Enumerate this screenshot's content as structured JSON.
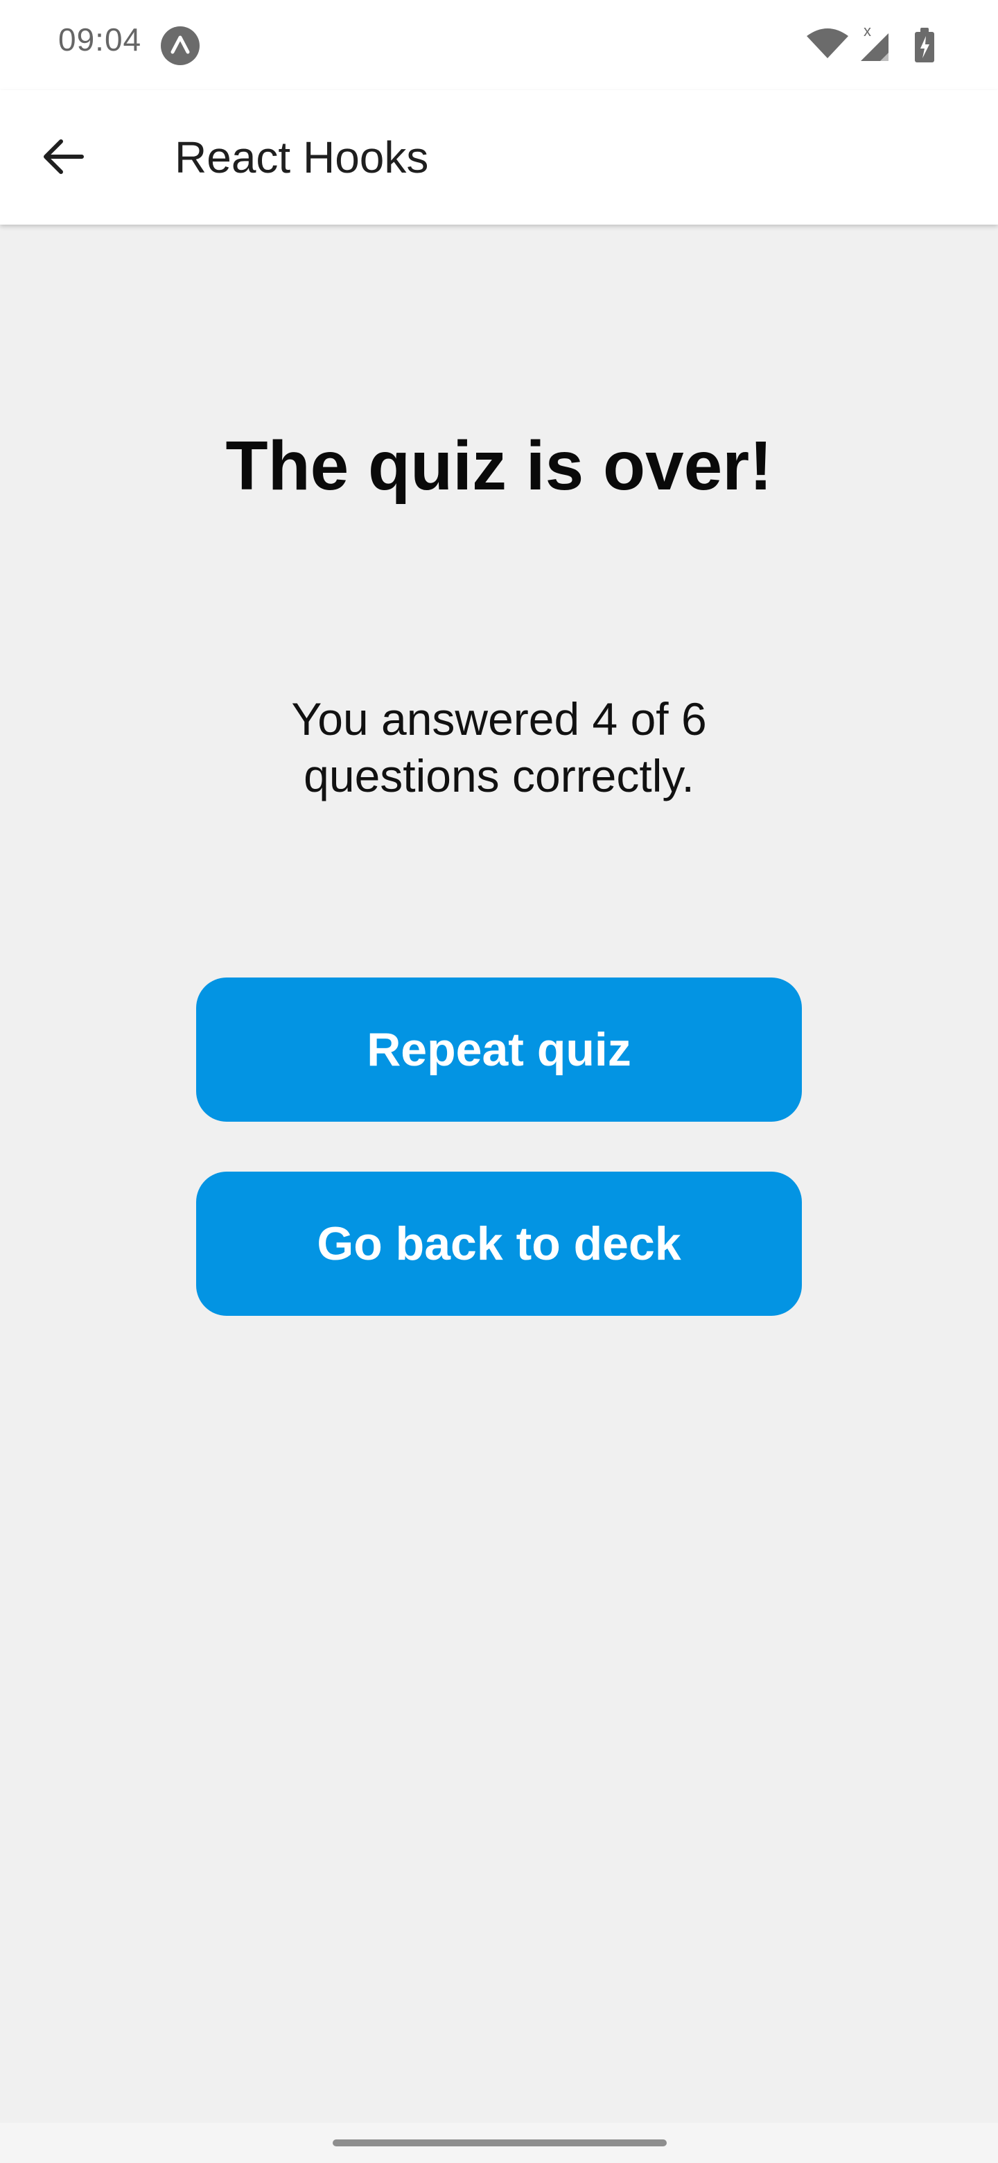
{
  "status_bar": {
    "time": "09:04",
    "app_icon": "expo-icon",
    "icons": [
      "wifi-icon",
      "signal-icon",
      "battery-charging-icon"
    ],
    "signal_label": "x"
  },
  "app_bar": {
    "back_icon": "arrow-back-icon",
    "title": "React Hooks"
  },
  "quiz": {
    "title": "The quiz is over!",
    "result_line": "You answered 4 of 6 questions correctly.",
    "correct": 4,
    "total": 6
  },
  "buttons": {
    "repeat_label": "Repeat quiz",
    "back_label": "Go back to deck"
  },
  "colors": {
    "accent": "#0394e3",
    "background": "#f0f0f0"
  }
}
